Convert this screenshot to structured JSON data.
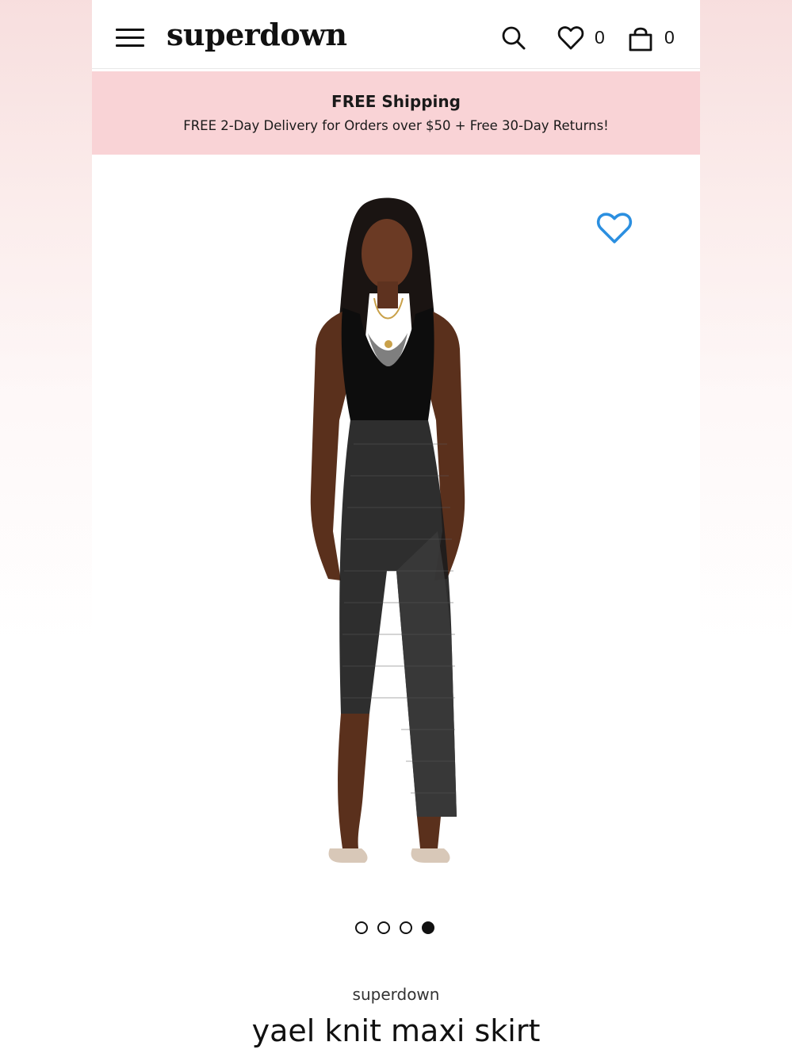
{
  "header": {
    "logo": "superdown",
    "wishlist_count": "0",
    "bag_count": "0"
  },
  "banner": {
    "title": "FREE Shipping",
    "subtitle": "FREE 2-Day Delivery for Orders over $50 + Free 30-Day Returns!"
  },
  "carousel": {
    "slide_count": 4,
    "active_index": 3
  },
  "product": {
    "brand": "superdown",
    "name": "yael knit maxi skirt"
  },
  "colors": {
    "banner_bg": "#f9d3d6",
    "favorite_heart": "#2b8fe0",
    "text": "#111111"
  },
  "icons": [
    "menu-icon",
    "search-icon",
    "heart-outline-icon",
    "shopping-bag-icon",
    "favorite-heart-icon"
  ]
}
